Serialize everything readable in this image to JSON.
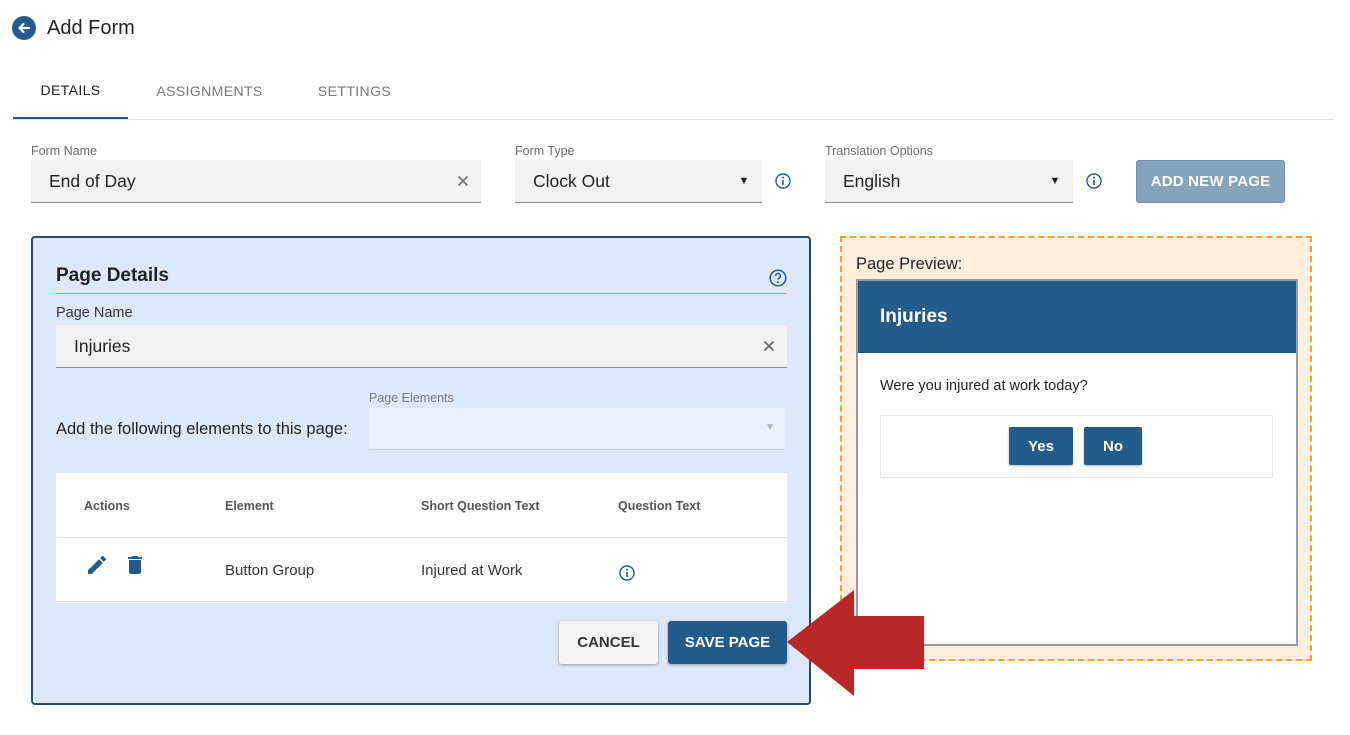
{
  "header": {
    "title": "Add Form"
  },
  "tabs": [
    {
      "label": "DETAILS"
    },
    {
      "label": "ASSIGNMENTS"
    },
    {
      "label": "SETTINGS"
    }
  ],
  "form": {
    "form_name": {
      "label": "Form Name",
      "value": "End of Day"
    },
    "form_type": {
      "label": "Form Type",
      "value": "Clock Out"
    },
    "translation": {
      "label": "Translation Options",
      "value": "English"
    },
    "add_page_label": "ADD NEW PAGE"
  },
  "page_details": {
    "title": "Page Details",
    "page_name": {
      "label": "Page Name",
      "value": "Injuries"
    },
    "page_elements": {
      "label": "Page Elements",
      "prompt": "Add the following elements to this page:"
    },
    "table": {
      "headers": [
        "Actions",
        "Element",
        "Short Question Text",
        "Question Text"
      ],
      "rows": [
        {
          "element": "Button Group",
          "short_question": "Injured at Work"
        }
      ]
    },
    "cancel_label": "CANCEL",
    "save_label": "SAVE PAGE"
  },
  "preview": {
    "label": "Page Preview:",
    "title": "Injuries",
    "question": "Were you injured at work today?",
    "buttons": [
      "Yes",
      "No"
    ]
  },
  "icons": {
    "back": "arrow-left-circle-icon",
    "clear": "close-icon",
    "info": "info-circle-icon",
    "help": "help-circle-icon",
    "edit": "pencil-icon",
    "delete": "trash-icon",
    "pointer": "red-arrow-left-icon"
  },
  "colors": {
    "primary": "#255b8a",
    "panel_bg": "#dde9fb",
    "preview_bg": "#fdeedd",
    "preview_border": "#f0a030",
    "annotation_arrow": "#b92828"
  }
}
